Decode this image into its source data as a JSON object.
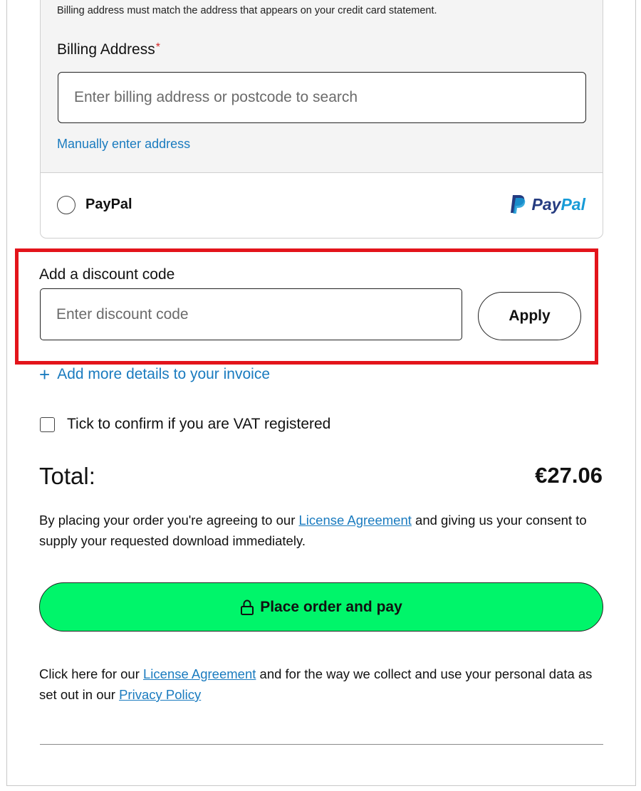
{
  "billing": {
    "note": "Billing address must match the address that appears on your credit card statement.",
    "label": "Billing Address",
    "required_marker": "*",
    "input_placeholder": "Enter billing address or postcode to search",
    "manual_link": "Manually enter address"
  },
  "paypal": {
    "option_label": "PayPal",
    "logo_text_pay": "Pay",
    "logo_text_pal": "Pal",
    "selected": false
  },
  "discount": {
    "label": "Add a discount code",
    "input_placeholder": "Enter discount code",
    "apply_label": "Apply"
  },
  "invoice": {
    "link_label": "Add more details to your invoice"
  },
  "vat": {
    "label": "Tick to confirm if you are VAT registered",
    "checked": false
  },
  "total": {
    "label": "Total:",
    "value": "€27.06"
  },
  "agreement": {
    "before": "By placing your order you're agreeing to our ",
    "link": "License Agreement",
    "after": " and giving us your consent to supply your requested download immediately."
  },
  "place_order": {
    "label": "Place order and pay"
  },
  "footer": {
    "before": "Click here for our ",
    "license_link": "License Agreement",
    "middle": " and for the way we collect and use your personal data as set out in our ",
    "privacy_link": "Privacy Policy"
  },
  "colors": {
    "accent_link": "#1a7bbf",
    "cta_green": "#00f56a",
    "highlight_red": "#e3141b",
    "paypal_dark": "#253b80",
    "paypal_light": "#179bd7"
  }
}
